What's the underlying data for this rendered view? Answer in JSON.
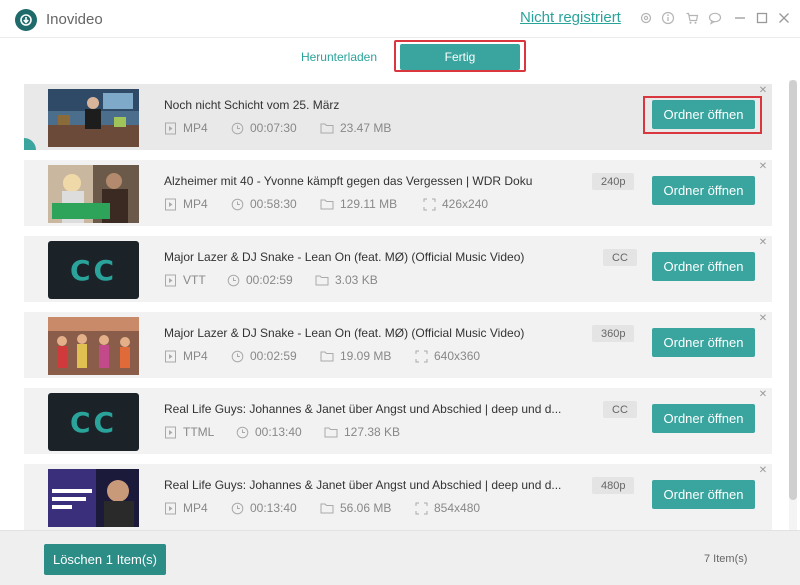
{
  "window": {
    "app_title": "Inovideo",
    "register_link": "Nicht registriert",
    "icons": [
      "settings-icon",
      "info-icon",
      "cart-icon",
      "chat-icon",
      "minimize-icon",
      "maximize-icon",
      "close-icon"
    ]
  },
  "tabs": {
    "download_label": "Herunterladen",
    "done_label": "Fertig",
    "active": "done"
  },
  "items": [
    {
      "title": "Noch nicht Schicht vom 25. März",
      "format": "MP4",
      "duration": "00:07:30",
      "size": "23.47 MB",
      "resolution": "",
      "badge": "",
      "thumb": "news-studio",
      "open_label": "Ordner öffnen",
      "selected": true
    },
    {
      "title": "Alzheimer mit 40 - Yvonne kämpft gegen das Vergessen | WDR Doku",
      "format": "MP4",
      "duration": "00:58:30",
      "size": "129.11 MB",
      "resolution": "426x240",
      "badge": "240p",
      "thumb": "documentary",
      "thumb_caption": "ICH LASS DICH NICHT ALLEIN!",
      "open_label": "Ordner öffnen"
    },
    {
      "title": "Major Lazer & DJ Snake - Lean On (feat. MØ) (Official Music Video)",
      "format": "VTT",
      "duration": "00:02:59",
      "size": "3.03 KB",
      "resolution": "",
      "badge": "CC",
      "thumb": "cc",
      "open_label": "Ordner öffnen"
    },
    {
      "title": "Major Lazer & DJ Snake - Lean On (feat. MØ) (Official Music Video)",
      "format": "MP4",
      "duration": "00:02:59",
      "size": "19.09 MB",
      "resolution": "640x360",
      "badge": "360p",
      "thumb": "music-video",
      "open_label": "Ordner öffnen"
    },
    {
      "title": "Real Life Guys: Johannes & Janet über Angst und Abschied | deep und d...",
      "format": "TTML",
      "duration": "00:13:40",
      "size": "127.38 KB",
      "resolution": "",
      "badge": "CC",
      "thumb": "cc",
      "open_label": "Ordner öffnen"
    },
    {
      "title": "Real Life Guys: Johannes & Janet über Angst und Abschied | deep und d...",
      "format": "MP4",
      "duration": "00:13:40",
      "size": "56.06 MB",
      "resolution": "854x480",
      "badge": "480p",
      "thumb": "interview",
      "thumb_caption": "Was bleibt nach Philipps Tod?",
      "open_label": "Ordner öffnen"
    }
  ],
  "cc_label": "CC",
  "footer": {
    "delete_label": "Löschen 1 Item(s)",
    "count_label": "7 Item(s)"
  },
  "colors": {
    "accent": "#3aa59f",
    "accent_dark": "#2c8c86",
    "highlight": "#d9363e"
  }
}
